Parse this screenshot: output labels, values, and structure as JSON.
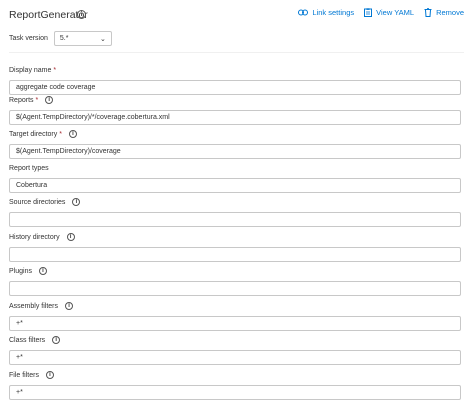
{
  "header": {
    "title": "ReportGenerator",
    "info_glyph": "i",
    "actions": {
      "link_settings": "Link settings",
      "view_yaml": "View YAML",
      "remove": "Remove"
    }
  },
  "task_version": {
    "label": "Task version",
    "value": "5.*"
  },
  "fields": {
    "display_name": {
      "label": "Display name",
      "required": "*",
      "value": "aggregate code coverage"
    },
    "reports": {
      "label": "Reports",
      "required": "*",
      "value": "$(Agent.TempDirectory)/*/coverage.cobertura.xml"
    },
    "target_directory": {
      "label": "Target directory",
      "required": "*",
      "value": "$(Agent.TempDirectory)/coverage"
    },
    "report_types": {
      "label": "Report types",
      "value": "Cobertura"
    },
    "source_directories": {
      "label": "Source directories",
      "value": ""
    },
    "history_directory": {
      "label": "History directory",
      "value": ""
    },
    "plugins": {
      "label": "Plugins",
      "value": ""
    },
    "assembly_filters": {
      "label": "Assembly filters",
      "value": "+*"
    },
    "class_filters": {
      "label": "Class filters",
      "value": "+*"
    },
    "file_filters": {
      "label": "File filters",
      "value": "+*"
    }
  },
  "colors": {
    "accent": "#0078d4",
    "required": "#a4262c",
    "border": "#c8c8c8"
  }
}
